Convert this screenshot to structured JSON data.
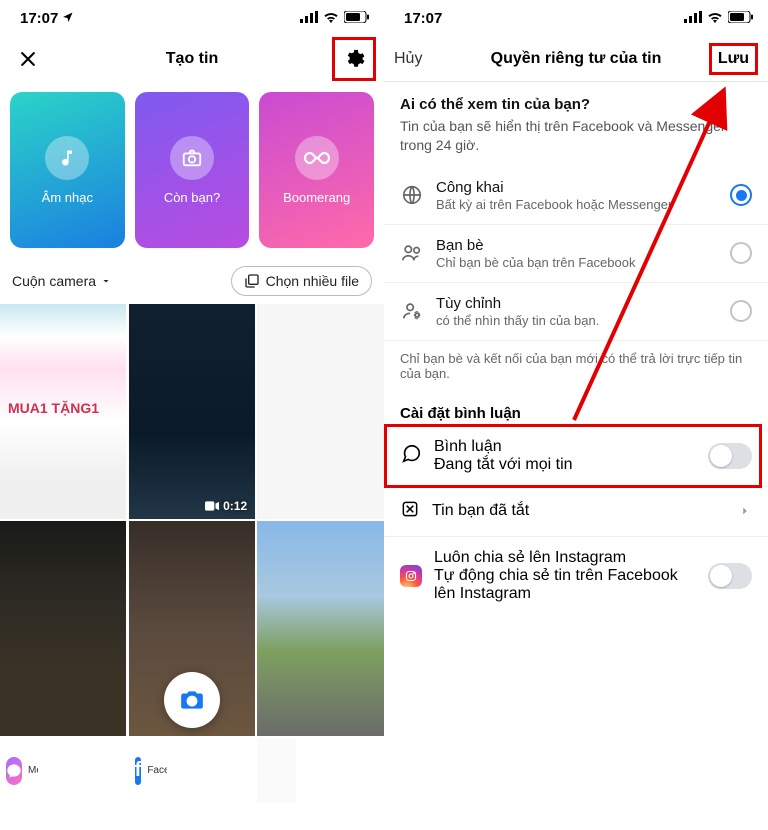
{
  "statusbar": {
    "time": "17:07"
  },
  "left": {
    "title": "Tạo tin",
    "cards": [
      {
        "label": "Âm nhạc"
      },
      {
        "label": "Còn bạn?"
      },
      {
        "label": "Boomerang"
      }
    ],
    "camera_roll_label": "Cuộn camera",
    "multi_select_label": "Chọn nhiều file",
    "video_duration": "0:12",
    "promo_text": "MUA1 TẶNG1",
    "apps": {
      "messenger": "Messenger",
      "facebook": "Facebook"
    }
  },
  "right": {
    "cancel": "Hủy",
    "title": "Quyền riêng tư của tin",
    "save": "Lưu",
    "who_heading": "Ai có thể xem tin của bạn?",
    "who_sub": "Tin của bạn sẽ hiển thị trên Facebook và Messenger trong 24 giờ.",
    "options": [
      {
        "label": "Công khai",
        "sub": "Bất kỳ ai trên Facebook hoặc Messenger",
        "checked": true
      },
      {
        "label": "Bạn bè",
        "sub": "Chỉ bạn bè của bạn trên Facebook",
        "checked": false
      },
      {
        "label": "Tùy chỉnh",
        "sub": "có thể nhìn thấy tin của bạn.",
        "checked": false
      }
    ],
    "reply_note": "Chỉ bạn bè và kết nối của bạn mới có thể trả lời trực tiếp tin của bạn.",
    "comment_heading": "Cài đặt bình luận",
    "comment": {
      "label": "Bình luận",
      "sub": "Đang tắt với mọi tin"
    },
    "muted": {
      "label": "Tin bạn đã tắt"
    },
    "instagram": {
      "label": "Luôn chia sẻ lên Instagram",
      "sub": "Tự động chia sẻ tin trên Facebook lên Instagram"
    }
  }
}
